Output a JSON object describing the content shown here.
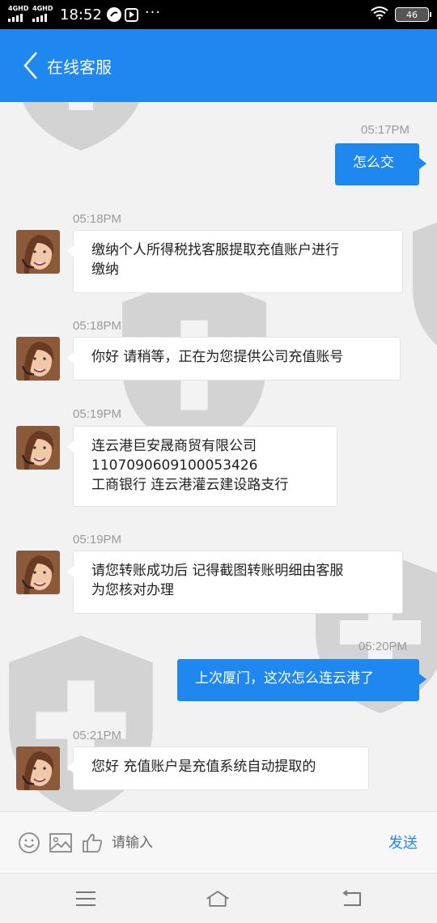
{
  "status_bar": {
    "signal1_label": "4GHD",
    "signal2_label": "4GHD",
    "time": "18:52",
    "dots": "···",
    "battery": "46"
  },
  "header": {
    "title": "在线客服",
    "color": "#1e88f0"
  },
  "messages": [
    {
      "time": "05:17PM",
      "text": "怎么交",
      "from": "me"
    },
    {
      "time": "05:18PM",
      "line1": "缴纳个人所得税找客服提取充值账户进行",
      "line2": "缴纳",
      "from": "agent"
    },
    {
      "time": "05:18PM",
      "text": "你好 请稍等，正在为您提供公司充值账号",
      "from": "agent"
    },
    {
      "time": "05:19PM",
      "line1": "连云港巨安晟商贸有限公司",
      "line2": "1107090609100053426",
      "line3": "工商银行 连云港灌云建设路支行",
      "from": "agent"
    },
    {
      "time": "05:19PM",
      "line1": "请您转账成功后 记得截图转账明细由客服",
      "line2": "为您核对办理",
      "from": "agent"
    },
    {
      "time": "05:20PM",
      "text": "上次厦门，这次怎么连云港了",
      "from": "me"
    },
    {
      "time": "05:21PM",
      "text": "您好 充值账户是充值系统自动提取的",
      "from": "agent"
    }
  ],
  "input_bar": {
    "placeholder": "请输入",
    "send_label": "发送"
  },
  "icons": {
    "emoji": "emoji-icon",
    "image": "image-icon",
    "thumb": "thumbs-up-icon",
    "menu": "menu-icon",
    "home": "home-icon",
    "back": "back-icon"
  }
}
